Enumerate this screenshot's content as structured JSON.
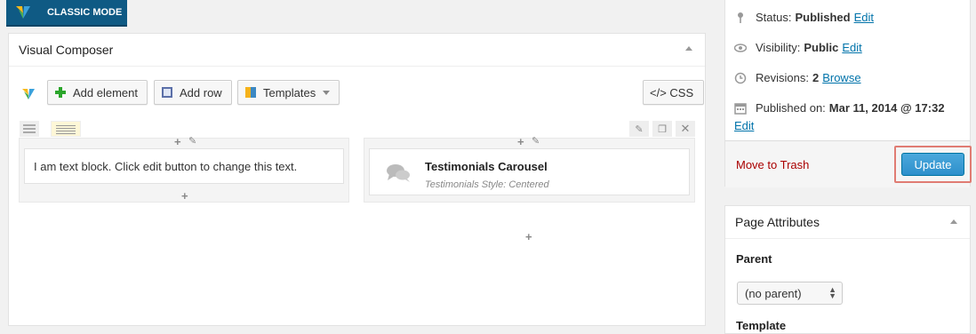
{
  "classic_mode": {
    "label": "CLASSIC MODE"
  },
  "composer": {
    "title": "Visual Composer",
    "toolbar": {
      "add_element": "Add element",
      "add_row": "Add row",
      "templates": "Templates",
      "css": "</> CSS"
    },
    "columns": [
      {
        "element_text": "I am text block. Click edit button to change this text."
      },
      {
        "element_title": "Testimonials Carousel",
        "element_subtitle": "Testimonials Style: Centered"
      }
    ]
  },
  "publish": {
    "status_label": "Status:",
    "status_value": "Published",
    "status_edit": "Edit",
    "visibility_label": "Visibility:",
    "visibility_value": "Public",
    "visibility_edit": "Edit",
    "revisions_label": "Revisions:",
    "revisions_value": "2",
    "revisions_browse": "Browse",
    "published_on_label": "Published on:",
    "published_on_value": "Mar 11, 2014 @ 17:32",
    "published_on_edit": "Edit",
    "move_to_trash": "Move to Trash",
    "update": "Update"
  },
  "page_attributes": {
    "title": "Page Attributes",
    "parent_label": "Parent",
    "parent_value": "(no parent)",
    "template_label": "Template"
  },
  "colors": {
    "accent": "#0073aa",
    "classic_bg": "#0f5a84",
    "update_btn": "#2e8fcb",
    "highlight": "#e07c73",
    "trash": "#aa0000"
  }
}
